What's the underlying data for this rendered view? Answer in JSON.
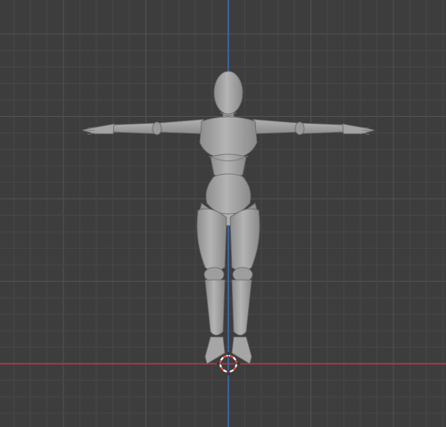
{
  "viewport": {
    "view": "front-orthographic",
    "grid_visible": true,
    "axes": {
      "x_axis_color": "#b13a4a",
      "z_axis_color": "#3a6fc4"
    },
    "grid_colors": {
      "background": "#3d3d3d",
      "minor": "#464646",
      "major": "#515151"
    }
  },
  "scene": {
    "object": {
      "type": "mannequin",
      "pose": "t-pose",
      "color": "#a8a8a8"
    },
    "cursor_3d": {
      "colors": [
        "#e05050",
        "#ffffff"
      ]
    }
  }
}
